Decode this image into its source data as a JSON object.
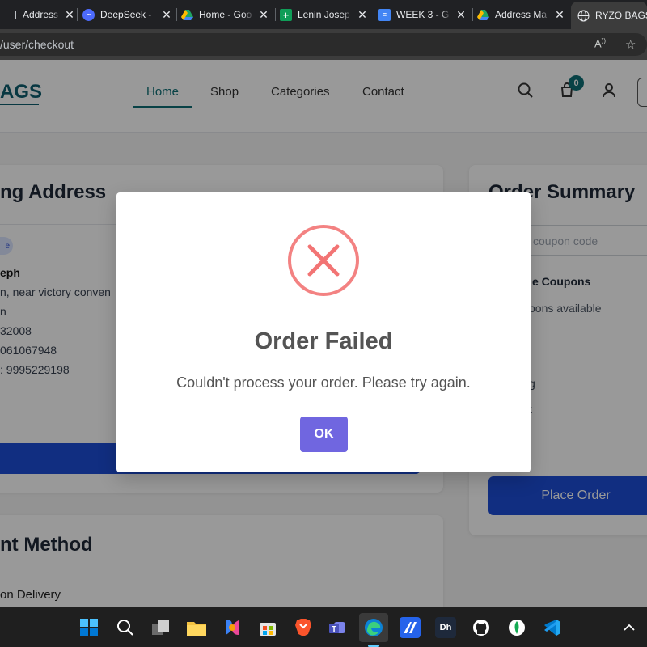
{
  "browser": {
    "tabs": [
      {
        "title": "Address Dis",
        "icon": "window-icon",
        "color": "#5f6368"
      },
      {
        "title": "DeepSeek -",
        "icon": "deepseek-icon",
        "color": "#4d6bfe"
      },
      {
        "title": "Home - Goo",
        "icon": "google-drive-icon",
        "color": "#1fa463"
      },
      {
        "title": "Lenin Josep",
        "icon": "google-sheets-icon",
        "color": "#0f9d58"
      },
      {
        "title": "WEEK 3 - G",
        "icon": "google-docs-icon",
        "color": "#4285f4"
      },
      {
        "title": "Address Ma",
        "icon": "google-drive-icon",
        "color": "#1fa463"
      },
      {
        "title": "RYZO BAGS",
        "icon": "globe-icon",
        "color": "#9aa0a6"
      }
    ],
    "url": "/user/checkout"
  },
  "nav": {
    "brand": "AGS",
    "links": [
      "Home",
      "Shop",
      "Categories",
      "Contact"
    ],
    "cart_count": "0"
  },
  "address_card": {
    "title": "ng Address",
    "lines": [
      "eph",
      "n, near victory conven",
      "n",
      "32008",
      "061067948",
      ": 9995229198"
    ]
  },
  "payment_card": {
    "title": "nt Method",
    "option": "on Delivery"
  },
  "summary": {
    "title": "Order Summary",
    "coupon_placeholder": "coupon code",
    "coupons_heading": "e Coupons",
    "coupons_text": "pons available",
    "rows": [
      "l",
      "g",
      "t"
    ],
    "place_order": "Place Order"
  },
  "modal": {
    "title": "Order Failed",
    "message": "Couldn't process your order. Please try again.",
    "ok": "OK",
    "icon_color": "#f27474",
    "button_color": "#7066e0"
  },
  "taskbar": {
    "icons": [
      "windows-start-icon",
      "search-icon",
      "task-view-icon",
      "file-explorer-icon",
      "copilot-icon",
      "microsoft-store-icon",
      "brave-icon",
      "teams-icon",
      "edge-icon",
      "mongodb-compass-icon",
      "dbeaver-icon",
      "github-icon",
      "mongodb-icon",
      "vscode-icon",
      "chevron-up-icon"
    ]
  }
}
